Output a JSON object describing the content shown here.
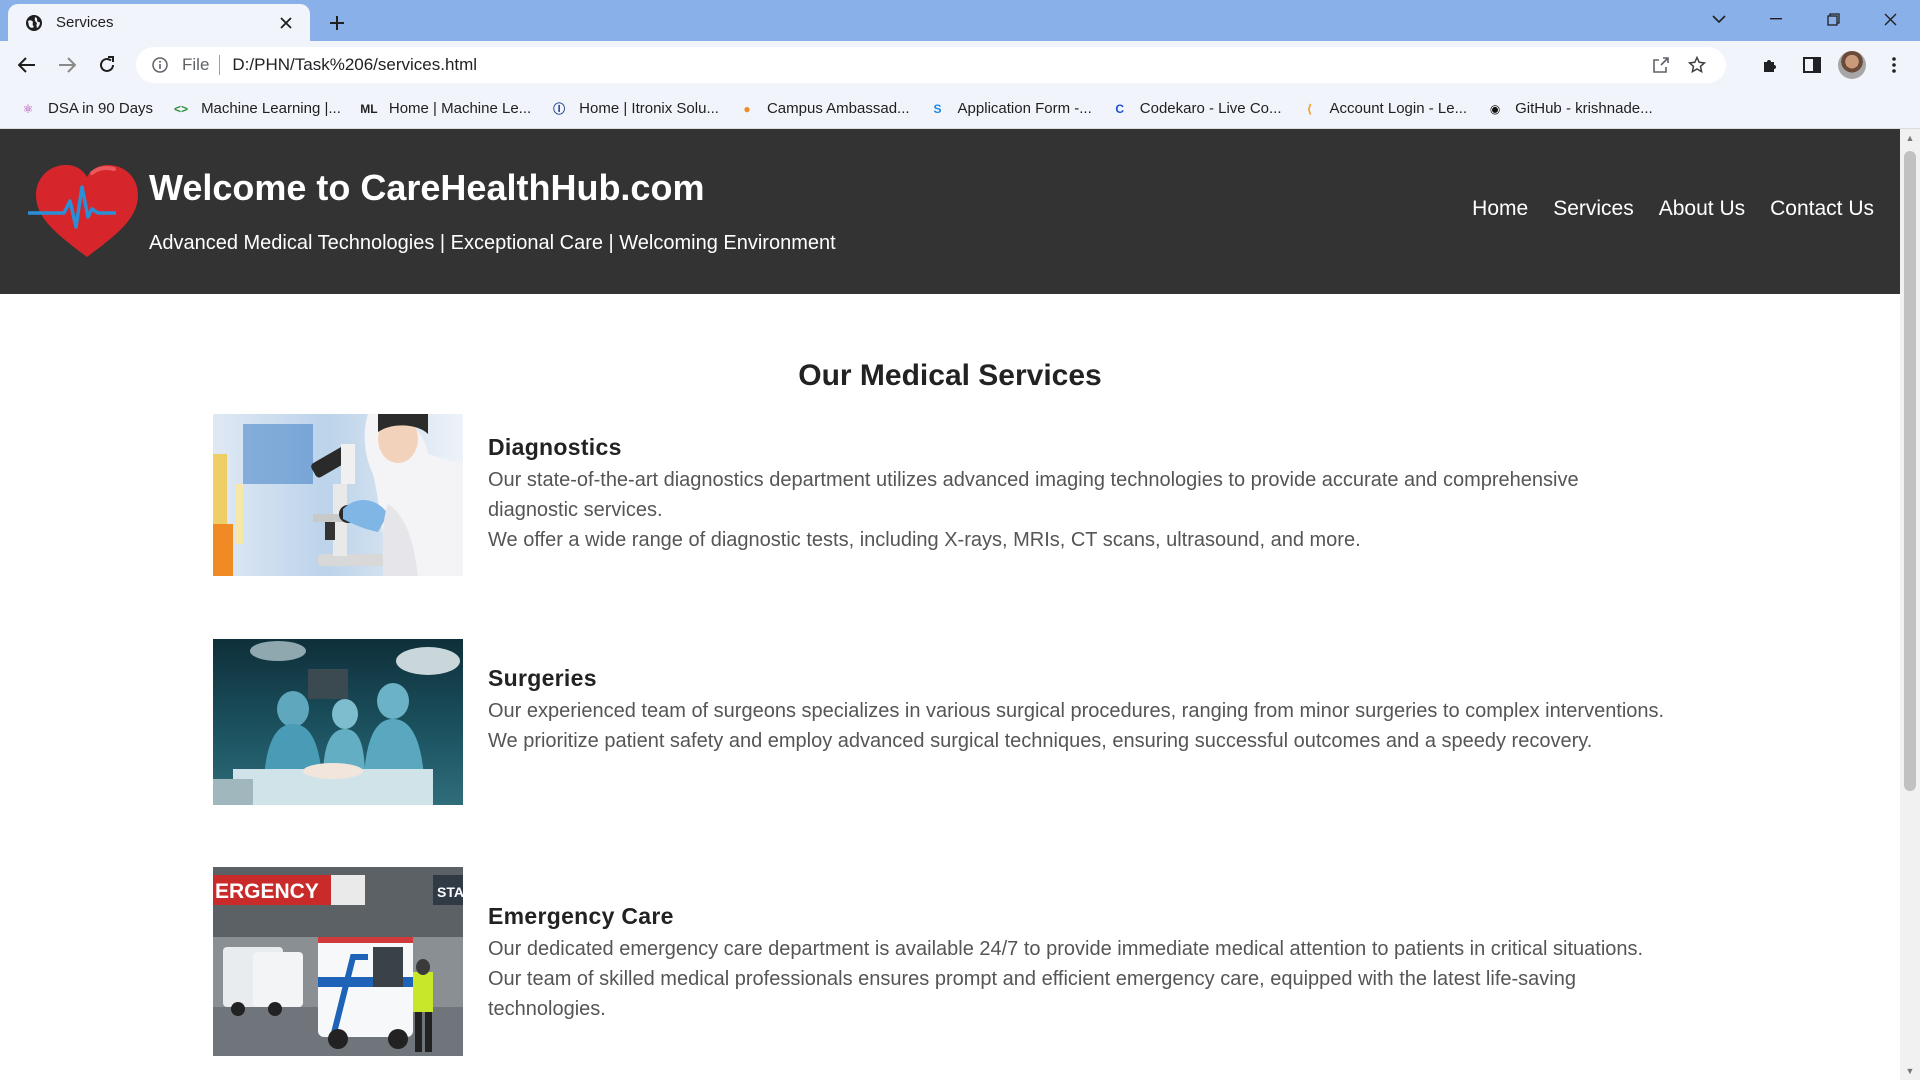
{
  "browser": {
    "tab_title": "Services",
    "address": {
      "scheme_label": "File",
      "url": "D:/PHN/Task%206/services.html"
    },
    "bookmarks": [
      {
        "label": "DSA in 90 Days",
        "icon": "dsa-icon",
        "color": "#b03aa8"
      },
      {
        "label": "Machine Learning  |...",
        "icon": "code-icon",
        "color": "#2c8c3a"
      },
      {
        "label": "Home | Machine Le...",
        "icon": "ml-icon",
        "color": "#222222"
      },
      {
        "label": "Home | Itronix Solu...",
        "icon": "itronix-icon",
        "color": "#1b3f8c"
      },
      {
        "label": "Campus Ambassad...",
        "icon": "campus-icon",
        "color": "#f08a24"
      },
      {
        "label": "Application Form -...",
        "icon": "s-icon",
        "color": "#1e88e5"
      },
      {
        "label": "Codekaro - Live Co...",
        "icon": "c-icon",
        "color": "#1a4fd8"
      },
      {
        "label": "Account Login - Le...",
        "icon": "leetcode-icon",
        "color": "#f4a024"
      },
      {
        "label": "GitHub - krishnade...",
        "icon": "github-icon",
        "color": "#111111"
      }
    ]
  },
  "site": {
    "title": "Welcome to CareHealthHub.com",
    "tagline": "Advanced Medical Technologies | Exceptional Care | Welcoming Environment",
    "nav": [
      "Home",
      "Services",
      "About Us",
      "Contact Us"
    ],
    "colors": {
      "header_bg": "#333333",
      "logo_heart": "#d7262b",
      "logo_pulse": "#2a8fd6"
    }
  },
  "page": {
    "heading": "Our Medical Services",
    "services": [
      {
        "title": "Diagnostics",
        "lines": [
          "Our state-of-the-art diagnostics department utilizes advanced imaging technologies to provide accurate and comprehensive diagnostic services.",
          "We offer a wide range of diagnostic tests, including X-rays, MRIs, CT scans, ultrasound, and more."
        ]
      },
      {
        "title": "Surgeries",
        "lines": [
          "Our experienced team of surgeons specializes in various surgical procedures, ranging from minor surgeries to complex interventions.",
          "We prioritize patient safety and employ advanced surgical techniques, ensuring successful outcomes and a speedy recovery."
        ]
      },
      {
        "title": "Emergency Care",
        "sign_text": "ERGENCY",
        "lines": [
          "Our dedicated emergency care department is available 24/7 to provide immediate medical attention to patients in critical situations.",
          "Our team of skilled medical professionals ensures prompt and efficient emergency care, equipped with the latest life-saving technologies."
        ]
      }
    ]
  }
}
